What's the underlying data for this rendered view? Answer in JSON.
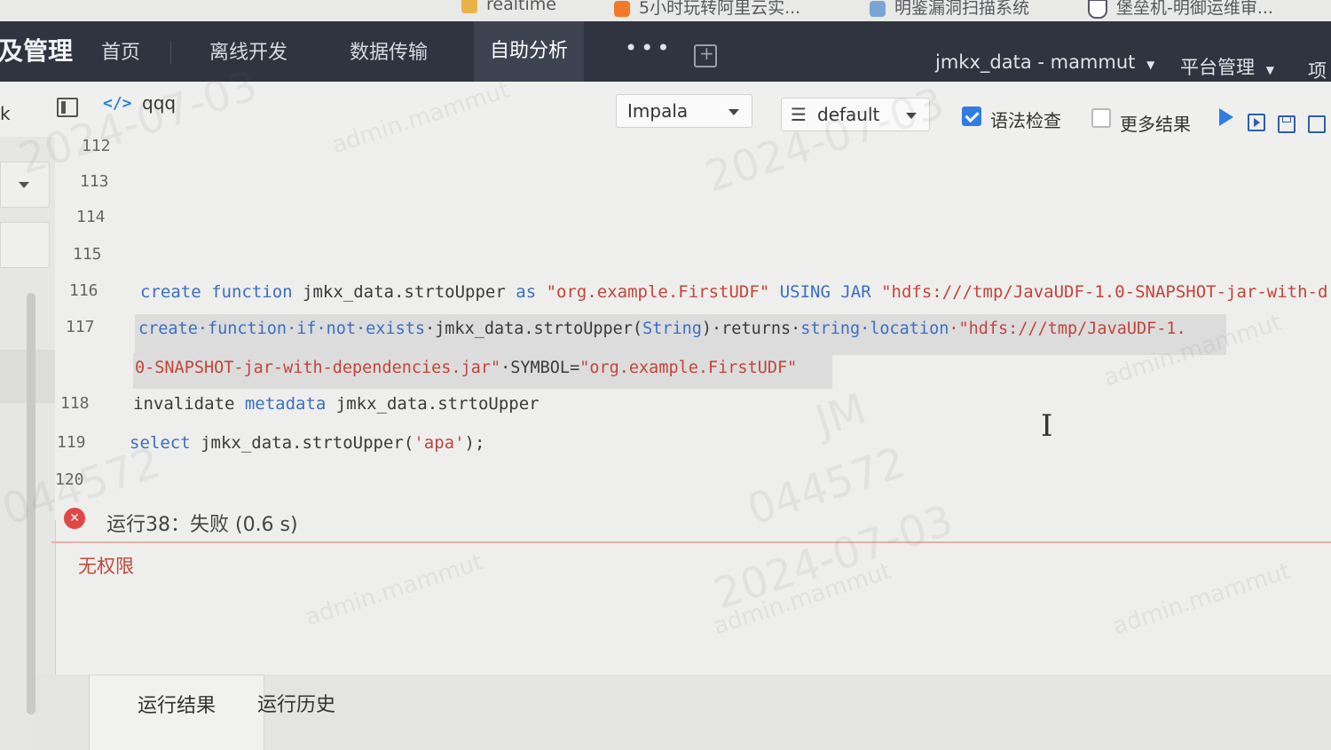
{
  "bookmarks": {
    "items": [
      {
        "label": "realtime"
      },
      {
        "label": "5小时玩转阿里云实..."
      },
      {
        "label": "明鉴漏洞扫描系统"
      },
      {
        "label": "堡垒机-明御运维审..."
      }
    ]
  },
  "nav": {
    "brand": "及管理",
    "items": [
      {
        "label": "首页"
      },
      {
        "label": "离线开发"
      },
      {
        "label": "数据传输"
      },
      {
        "label": "自助分析"
      }
    ],
    "more": "•••",
    "user": "jmkx_data - mammut",
    "admin": "平台管理",
    "project_short": "项"
  },
  "toolbar": {
    "left_label": "k",
    "script_name": "qqq",
    "engine": "Impala",
    "database": "default",
    "syntax_check_label": "语法检查",
    "syntax_check_checked": true,
    "more_results_label": "更多结果",
    "more_results_checked": false
  },
  "editor": {
    "lines": [
      {
        "num": "112"
      },
      {
        "num": "113"
      },
      {
        "num": "114"
      },
      {
        "num": "115"
      },
      {
        "num": "116"
      },
      {
        "num": "117"
      },
      {
        "num": "118"
      },
      {
        "num": "119"
      },
      {
        "num": "120"
      }
    ],
    "line116": {
      "t1": "create function",
      "t2": " jmkx_data.strtoUpper ",
      "t3": "as",
      "t4": " \"org.example.FirstUDF\"",
      "t5": " USING JAR ",
      "t6": "\"hdfs:///tmp/JavaUDF-1.0-SNAPSHOT-jar-with-d"
    },
    "line117a": {
      "t1": "create·function·if·not·exists",
      "t2": "·jmkx_data.strtoUpper(",
      "t3": "String",
      "t4": ")·returns·",
      "t5": "string·location",
      "t6": "·\"hdfs:///tmp/JavaUDF-1."
    },
    "line117b": {
      "t1": "0-SNAPSHOT-jar-with-dependencies.jar\"",
      "t2": "·SYMBOL=",
      "t3": "\"org.example.FirstUDF\""
    },
    "line118": {
      "t1": "invalidate ",
      "t2": "metadata",
      "t3": " jmkx_data.strtoUpper"
    },
    "line119": {
      "t1": "select",
      "t2": " jmkx_data.strtoUpper(",
      "t3": "'apa'",
      "t4": ");"
    }
  },
  "result": {
    "status": "运行38：失败 (0.6 s)",
    "error": "无权限"
  },
  "bottom_tabs": [
    {
      "label": "运行结果",
      "active": true
    },
    {
      "label": "运行历史",
      "active": false
    }
  ],
  "watermark": {
    "user": "admin.mammut",
    "date": "2024-07-03",
    "id": "044572",
    "initials": "JM"
  },
  "colors": {
    "nav_bg": "#2f3440",
    "keyword": "#3b6fc4",
    "string": "#c2453a",
    "error": "#e04848",
    "checkbox": "#2f7de0"
  }
}
